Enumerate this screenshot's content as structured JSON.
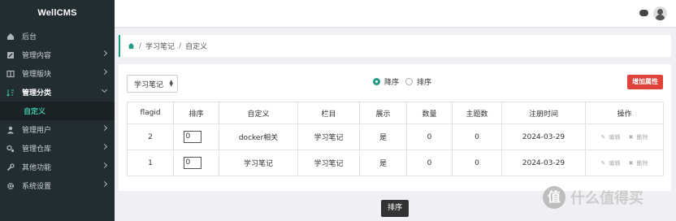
{
  "app": {
    "logo": "WellCMS"
  },
  "sidebar": {
    "items": [
      {
        "label": "后台",
        "icon": "dashboard-icon",
        "has_chevron": false
      },
      {
        "label": "管理内容",
        "icon": "edit-icon",
        "has_chevron": true
      },
      {
        "label": "管理版块",
        "icon": "columns-icon",
        "has_chevron": true
      },
      {
        "label": "管理分类",
        "icon": "sort-icon",
        "has_chevron": true,
        "active": true
      },
      {
        "label": "管理用户",
        "icon": "user-icon",
        "has_chevron": true
      },
      {
        "label": "管理仓库",
        "icon": "cogs-icon",
        "has_chevron": true
      },
      {
        "label": "其他功能",
        "icon": "wrench-icon",
        "has_chevron": true
      },
      {
        "label": "系统设置",
        "icon": "gear-icon",
        "has_chevron": true
      }
    ],
    "sub_item": "自定义"
  },
  "breadcrumb": {
    "items": [
      "学习笔记",
      "自定义"
    ],
    "separator": "/"
  },
  "filter": {
    "select_value": "学习笔记"
  },
  "sort_options": {
    "desc": "降序",
    "asc": "排序",
    "selected": "desc"
  },
  "add_button": "增加属性",
  "table": {
    "headers": [
      "flagid",
      "排序",
      "自定义",
      "栏目",
      "展示",
      "数量",
      "主题数",
      "注册时间",
      "操作"
    ],
    "rows": [
      {
        "flagid": "2",
        "order": "0",
        "name": "docker相关",
        "column": "学习笔记",
        "show": "是",
        "count": "0",
        "threads": "0",
        "date": "2024-03-29",
        "edit": "编辑",
        "delete": "删除"
      },
      {
        "flagid": "1",
        "order": "0",
        "name": "学习笔记",
        "column": "学习笔记",
        "show": "是",
        "count": "0",
        "threads": "0",
        "date": "2024-03-29",
        "edit": "编辑",
        "delete": "删除"
      }
    ]
  },
  "sort_button": "排序",
  "watermark": {
    "badge": "值",
    "text": "什么值得买"
  },
  "colors": {
    "sidebar_bg": "#222d32",
    "accent": "#1f9a83",
    "danger": "#e0423a"
  }
}
